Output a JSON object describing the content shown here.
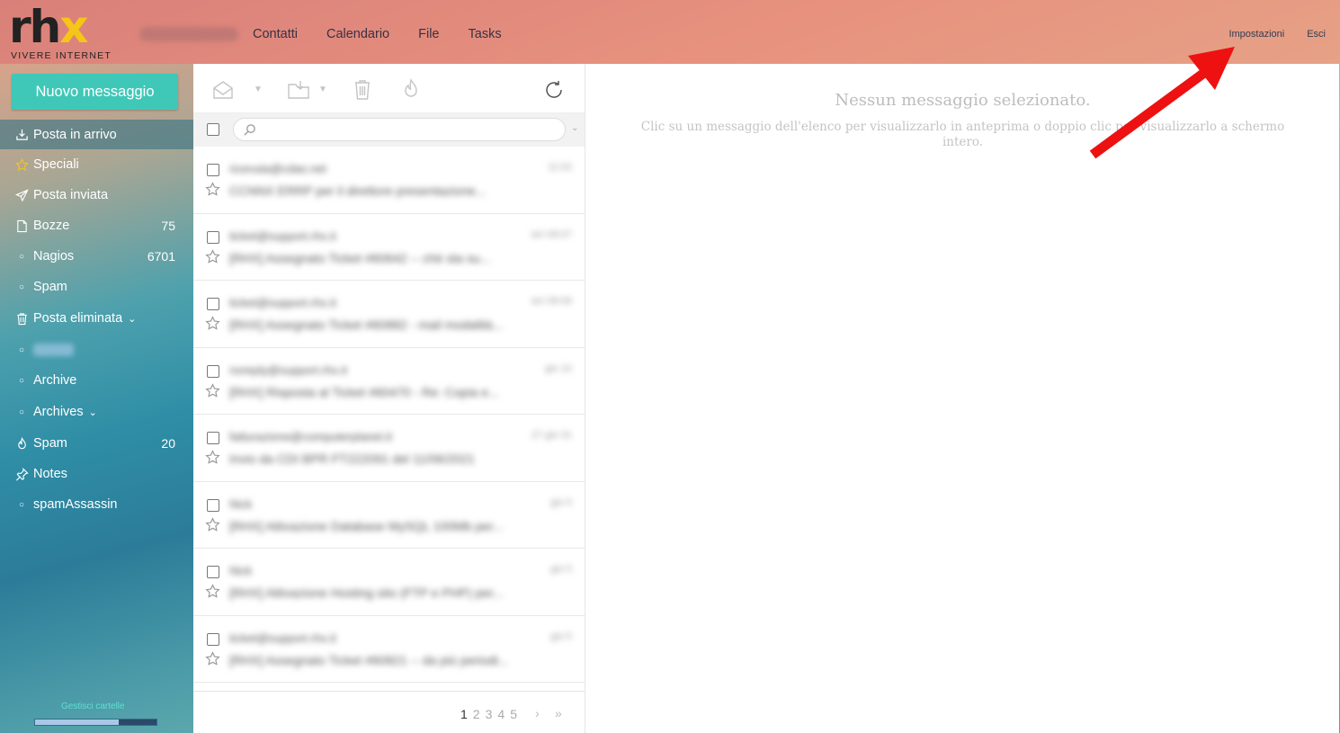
{
  "brand": {
    "logo_left": "rh",
    "logo_right": "x",
    "tagline": "VIVERE INTERNET"
  },
  "topnav": [
    {
      "label": "Contatti"
    },
    {
      "label": "Calendario"
    },
    {
      "label": "File"
    },
    {
      "label": "Tasks"
    }
  ],
  "topright": {
    "settings": "Impostazioni",
    "logout": "Esci"
  },
  "compose_label": "Nuovo messaggio",
  "folders": [
    {
      "label": "Posta in arrivo",
      "count": "",
      "icon": "inbox-icon"
    },
    {
      "label": "Speciali",
      "count": "",
      "icon": "star-icon"
    },
    {
      "label": "Posta inviata",
      "count": "",
      "icon": "send-icon"
    },
    {
      "label": "Bozze",
      "count": "75",
      "icon": "draft-icon"
    },
    {
      "label": "Nagios",
      "count": "6701",
      "icon": "folder-dot-icon"
    },
    {
      "label": "Spam",
      "count": "",
      "icon": "folder-dot-icon"
    },
    {
      "label": "Posta eliminata",
      "count": "",
      "icon": "trash-icon"
    },
    {
      "label": "Archive",
      "count": "",
      "icon": "folder-dot-icon"
    },
    {
      "label": "Archives",
      "count": "",
      "icon": "folder-dot-icon"
    },
    {
      "label": "Spam",
      "count": "20",
      "icon": "fire-icon"
    },
    {
      "label": "Notes",
      "count": "",
      "icon": "pin-icon"
    },
    {
      "label": "spamAssassin",
      "count": "",
      "icon": "folder-dot-icon"
    }
  ],
  "sidebar_footer": {
    "manage_label": "Gestisci cartelle",
    "quota_fraction": 0.69
  },
  "messages": [
    {
      "from": "ricevuta@cdas.net",
      "date": "11:02",
      "subject": "CCNNX ERRP per il direttore presentazione..."
    },
    {
      "from": "ticket@support.rhx.it",
      "date": "ieri 08:07",
      "subject": "[RHX] Assegnato Ticket #60642 -- chè sta su..."
    },
    {
      "from": "ticket@support.rhx.it",
      "date": "ieri 08:06",
      "subject": "[RHX] Assegnato Ticket #60882 - mail modalità..."
    },
    {
      "from": "noreply@support.rhx.it",
      "date": "gio 10",
      "subject": "[RHX] Risposta al Ticket #60470 - Re: Copia e..."
    },
    {
      "from": "fatturazione@computerplanet.it",
      "date": "27 gio 31",
      "subject": "Invio da CDI BPR FT222091 del 11/06/2021"
    },
    {
      "from": "Nick",
      "date": "gio 5",
      "subject": "[RHX] Attivazione Database MySQL 100Mb per..."
    },
    {
      "from": "Nick",
      "date": "gio 5",
      "subject": "[RHX] Attivazione Hosting sito (FTP e PHP) per..."
    },
    {
      "from": "ticket@support.rhx.it",
      "date": "gio 5",
      "subject": "[RHX] Assegnato Ticket #60821 -- da più periodi..."
    }
  ],
  "pagination": {
    "pages": [
      "1",
      "2",
      "3",
      "4",
      "5"
    ],
    "current": "1"
  },
  "preview": {
    "title": "Nessun messaggio selezionato.",
    "hint": "Clic su un messaggio dell'elenco per visualizzarlo in anteprima o doppio clic per visualizzarlo a schermo intero."
  },
  "colors": {
    "accent": "#3fc8b7",
    "annotation_arrow": "#ee1111"
  }
}
